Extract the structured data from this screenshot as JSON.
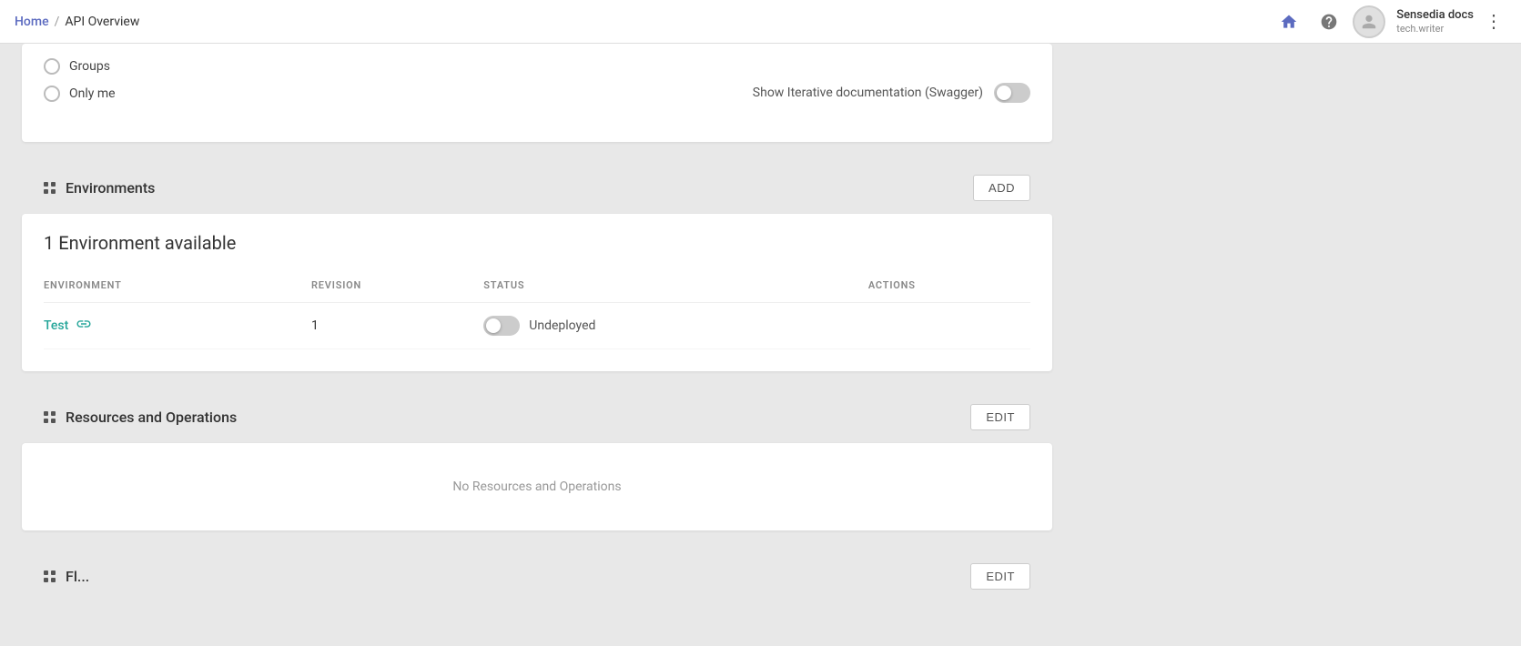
{
  "topnav": {
    "home_label": "Home",
    "separator": "/",
    "current_page": "API Overview",
    "home_icon": "🏠",
    "help_icon": "?",
    "user_name": "Sensedia docs",
    "user_email": "tech.writer",
    "more_icon": "⋮"
  },
  "top_card": {
    "radio_groups": [
      {
        "label": "Groups"
      },
      {
        "label": "Only me"
      }
    ],
    "swagger_label": "Show Iterative documentation (Swagger)"
  },
  "environments": {
    "section_title": "Environments",
    "add_button": "ADD",
    "count_label": "1 Environment available",
    "table_headers": {
      "environment": "ENVIRONMENT",
      "revision": "REVISION",
      "status": "STATUS",
      "actions": "ACTIONS"
    },
    "rows": [
      {
        "name": "Test",
        "revision": "1",
        "status": "Undeployed",
        "deployed": false
      }
    ]
  },
  "resources_ops": {
    "section_title": "Resources and Operations",
    "edit_button": "EDIT",
    "empty_message": "No Resources and Operations"
  },
  "bottom_section": {
    "section_title": "Fl...",
    "edit_button": "EDIT"
  }
}
